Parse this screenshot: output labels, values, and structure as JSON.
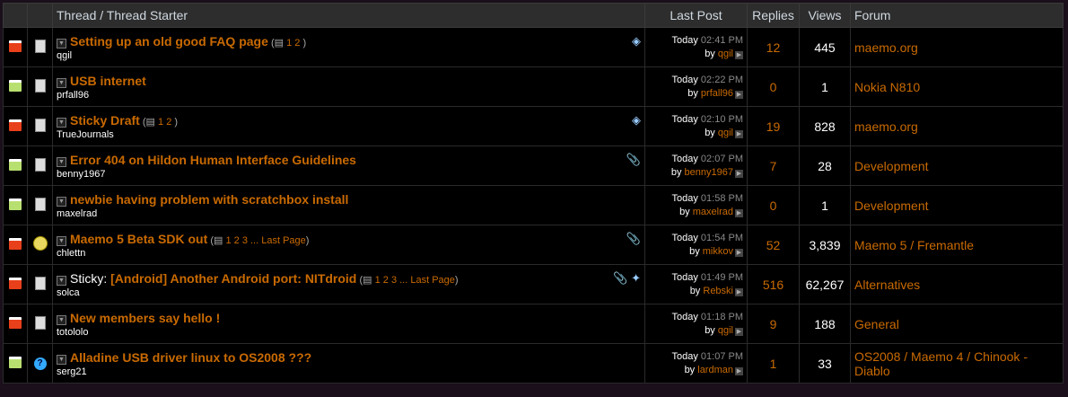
{
  "header": {
    "thread": "Thread / Thread Starter",
    "last_post": "Last Post",
    "replies": "Replies",
    "views": "Views",
    "forum": "Forum"
  },
  "colors": {
    "accent": "#c96a00",
    "header_bg": "#2d2d2d"
  },
  "threads": [
    {
      "status": "hot",
      "icon": "document-icon",
      "prefix": "",
      "title": "Setting up an old good FAQ page",
      "pages": [
        "1",
        "2"
      ],
      "last_page": "",
      "starter": "qgil",
      "tag": true,
      "attach": false,
      "poll": false,
      "day": "Today",
      "time": "02:41 PM",
      "by": "by",
      "last_user": "qgil",
      "replies": "12",
      "views": "445",
      "forum": "maemo.org"
    },
    {
      "status": "new",
      "icon": "document-icon",
      "prefix": "",
      "title": "USB internet",
      "pages": [],
      "last_page": "",
      "starter": "prfall96",
      "tag": false,
      "attach": false,
      "poll": false,
      "day": "Today",
      "time": "02:22 PM",
      "by": "by",
      "last_user": "prfall96",
      "replies": "0",
      "views": "1",
      "forum": "Nokia N810"
    },
    {
      "status": "hot",
      "icon": "document-icon",
      "prefix": "",
      "title": "Sticky Draft",
      "pages": [
        "1",
        "2"
      ],
      "last_page": "",
      "starter": "TrueJournals",
      "tag": true,
      "attach": false,
      "poll": false,
      "day": "Today",
      "time": "02:10 PM",
      "by": "by",
      "last_user": "qgil",
      "replies": "19",
      "views": "828",
      "forum": "maemo.org"
    },
    {
      "status": "new",
      "icon": "document-icon",
      "prefix": "",
      "title": "Error 404 on Hildon Human Interface Guidelines",
      "pages": [],
      "last_page": "",
      "starter": "benny1967",
      "tag": false,
      "attach": true,
      "poll": false,
      "day": "Today",
      "time": "02:07 PM",
      "by": "by",
      "last_user": "benny1967",
      "replies": "7",
      "views": "28",
      "forum": "Development"
    },
    {
      "status": "new",
      "icon": "document-icon",
      "prefix": "",
      "title": "newbie having problem with scratchbox install",
      "pages": [],
      "last_page": "",
      "starter": "maxelrad",
      "tag": false,
      "attach": false,
      "poll": false,
      "day": "Today",
      "time": "01:58 PM",
      "by": "by",
      "last_user": "maxelrad",
      "replies": "0",
      "views": "1",
      "forum": "Development"
    },
    {
      "status": "hot-moved",
      "icon": "smile-icon",
      "prefix": "",
      "title": "Maemo 5 Beta SDK out",
      "pages": [
        "1",
        "2",
        "3",
        "..."
      ],
      "last_page": "Last Page",
      "starter": "chlettn",
      "tag": false,
      "attach": true,
      "poll": false,
      "day": "Today",
      "time": "01:54 PM",
      "by": "by",
      "last_user": "mikkov",
      "replies": "52",
      "views": "3,839",
      "forum": "Maemo 5 / Fremantle"
    },
    {
      "status": "hot-moved",
      "icon": "document-icon",
      "prefix": "Sticky: ",
      "title": "[Android] Another Android port: NITdroid",
      "pages": [
        "1",
        "2",
        "3",
        "..."
      ],
      "last_page": "Last Page",
      "starter": "solca",
      "tag": false,
      "attach": true,
      "poll": true,
      "day": "Today",
      "time": "01:49 PM",
      "by": "by",
      "last_user": "Rebski",
      "replies": "516",
      "views": "62,267",
      "forum": "Alternatives"
    },
    {
      "status": "hot",
      "icon": "document-icon",
      "prefix": "",
      "title": "New members say hello !",
      "pages": [],
      "last_page": "",
      "starter": "totololo",
      "tag": false,
      "attach": false,
      "poll": false,
      "day": "Today",
      "time": "01:18 PM",
      "by": "by",
      "last_user": "qgil",
      "replies": "9",
      "views": "188",
      "forum": "General"
    },
    {
      "status": "new",
      "icon": "question-icon",
      "prefix": "",
      "title": "Alladine USB driver linux to OS2008 ???",
      "pages": [],
      "last_page": "",
      "starter": "serg21",
      "tag": false,
      "attach": false,
      "poll": false,
      "day": "Today",
      "time": "01:07 PM",
      "by": "by",
      "last_user": "lardman",
      "replies": "1",
      "views": "33",
      "forum": "OS2008 / Maemo 4 / Chinook - Diablo"
    }
  ]
}
